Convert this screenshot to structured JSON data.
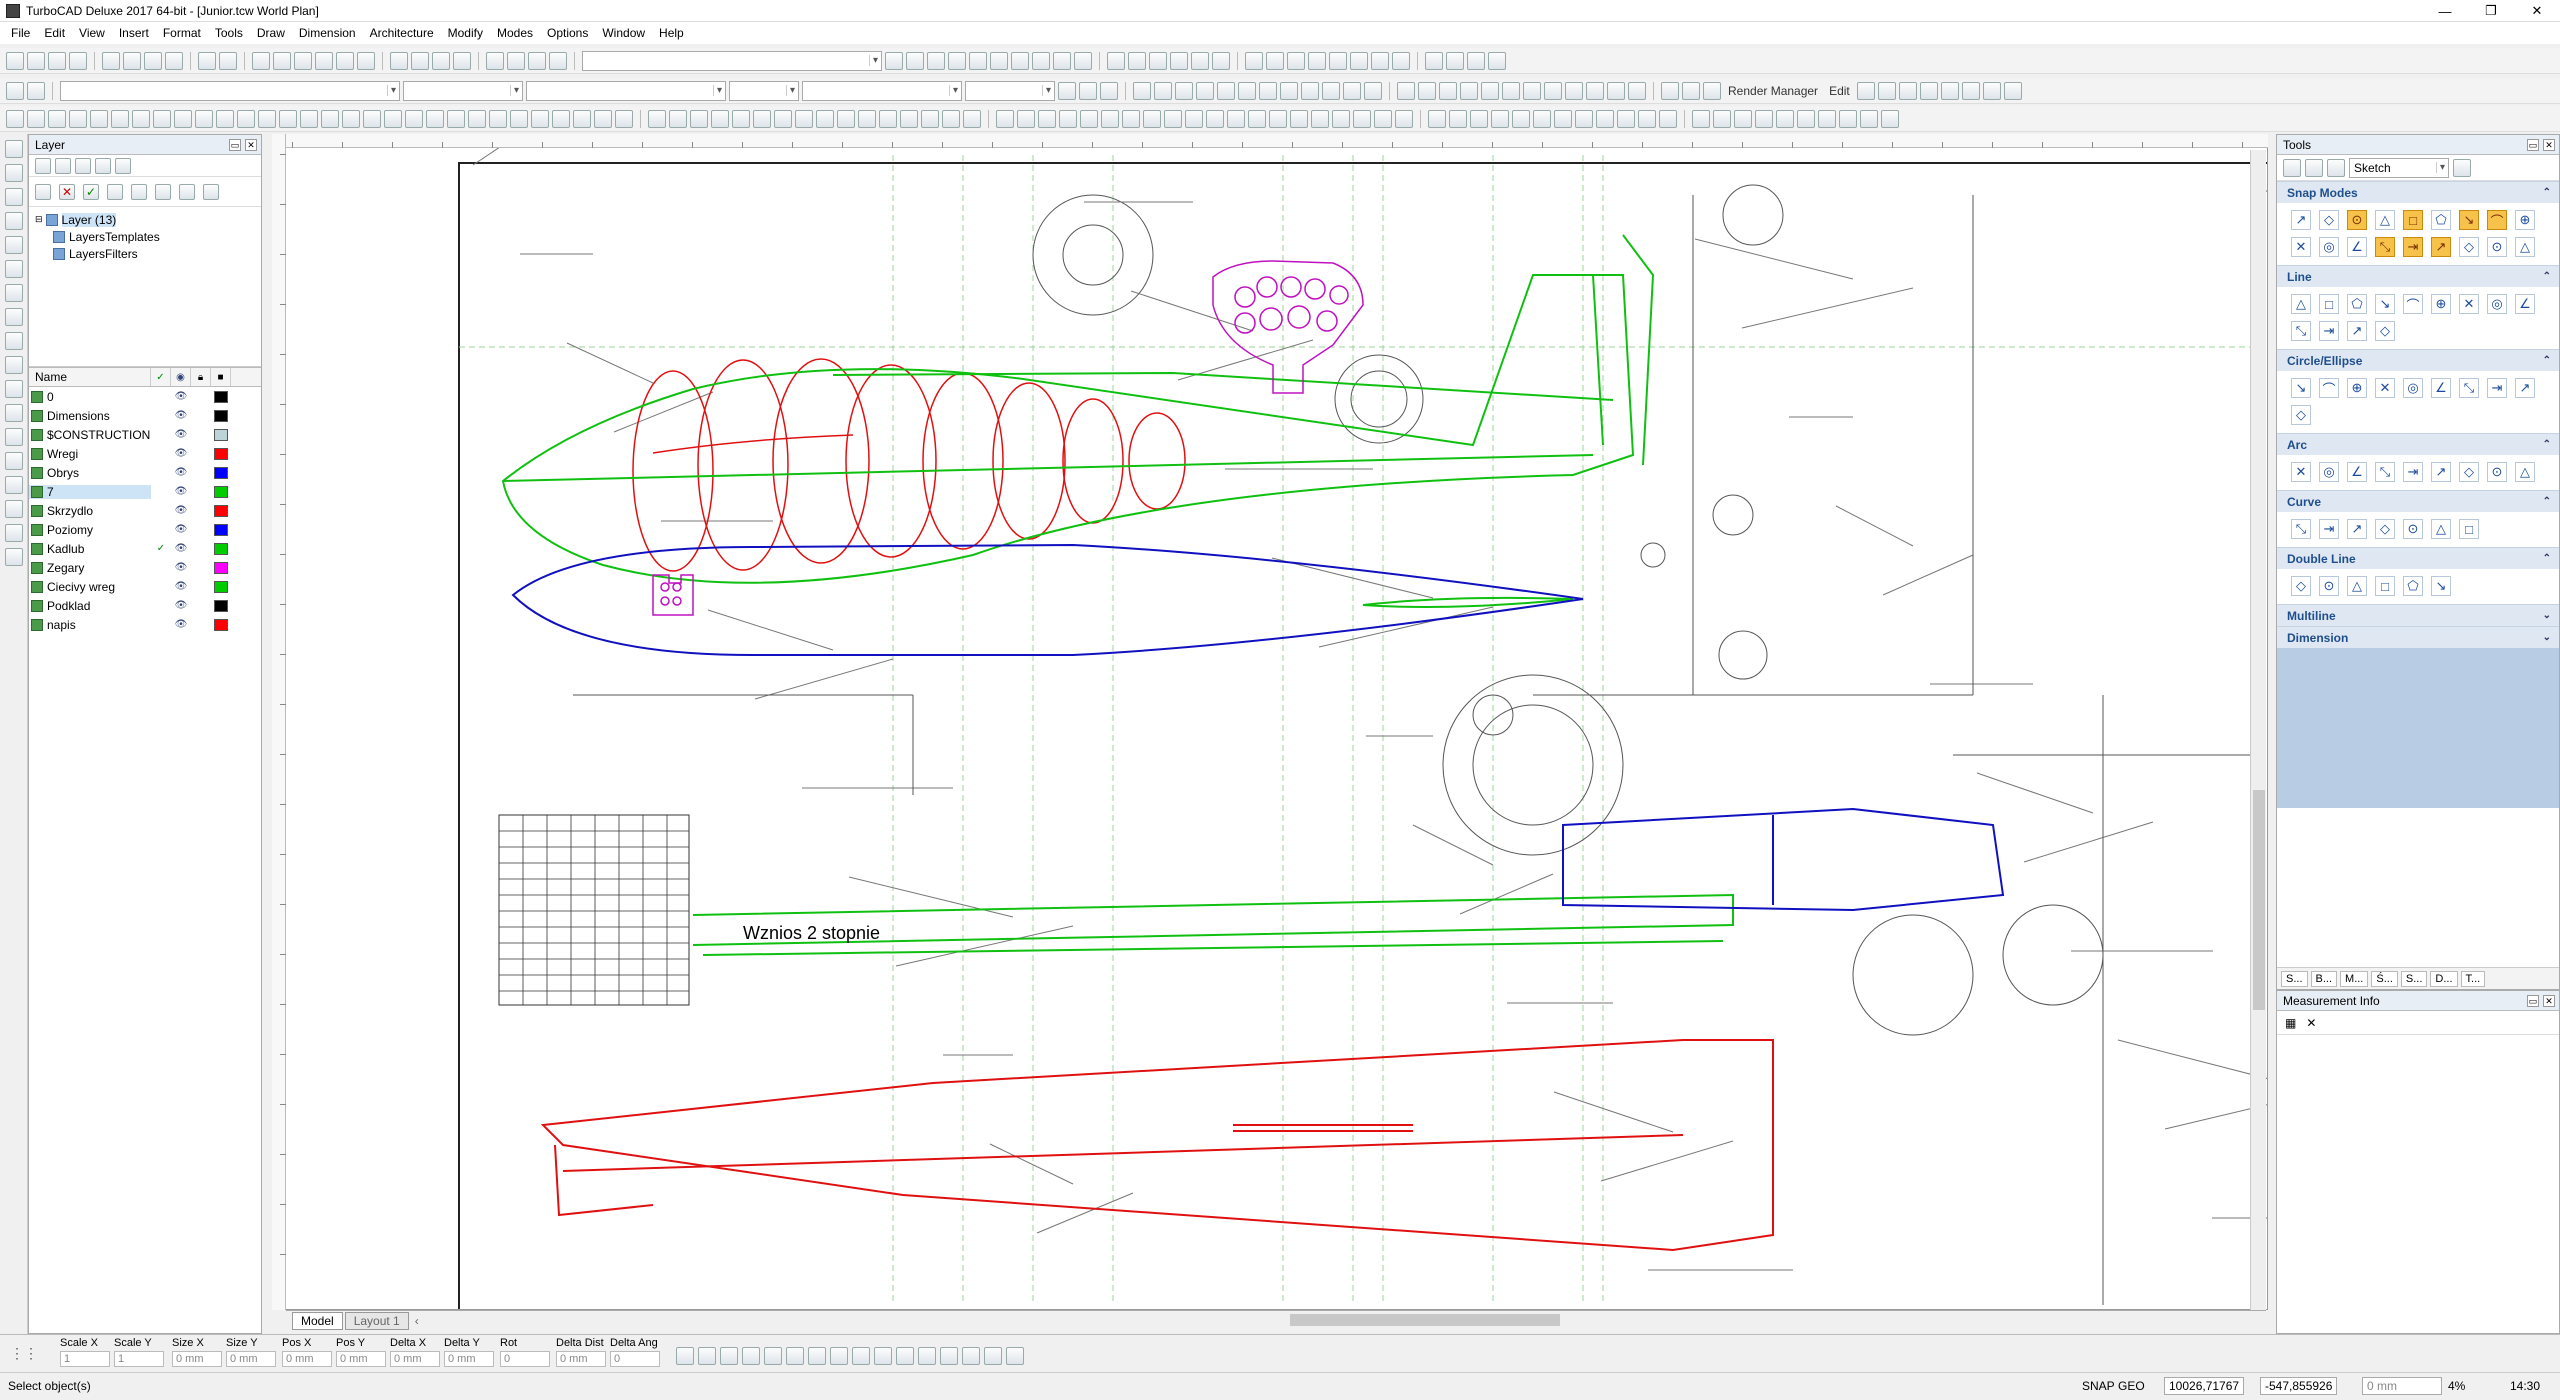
{
  "window": {
    "title": "TurboCAD Deluxe 2017 64-bit - [Junior.tcw World Plan]",
    "controls": [
      "—",
      "❐",
      "✕"
    ]
  },
  "menu": [
    "File",
    "Edit",
    "View",
    "Insert",
    "Format",
    "Tools",
    "Draw",
    "Dimension",
    "Architecture",
    "Modify",
    "Modes",
    "Options",
    "Window",
    "Help"
  ],
  "toolbar": {
    "render_manager_label": "Render Manager",
    "edit_label": "Edit"
  },
  "layer_panel": {
    "title": "Layer",
    "tree": [
      {
        "label": "Layer (13)"
      },
      {
        "label": "LayersTemplates"
      },
      {
        "label": "LayersFilters"
      }
    ],
    "columns": {
      "name": "Name"
    },
    "layers": [
      {
        "name": "0",
        "visible": true,
        "current": false,
        "color": "#000000"
      },
      {
        "name": "Dimensions",
        "visible": true,
        "current": false,
        "color": "#000000"
      },
      {
        "name": "$CONSTRUCTION",
        "visible": true,
        "current": false,
        "color": "#bcd3d8"
      },
      {
        "name": "Wregi",
        "visible": true,
        "current": false,
        "color": "#ff0000"
      },
      {
        "name": "Obrys",
        "visible": true,
        "current": false,
        "color": "#0000ff"
      },
      {
        "name": "7",
        "visible": true,
        "current": false,
        "color": "#00cc00"
      },
      {
        "name": "Skrzydlo",
        "visible": true,
        "current": false,
        "color": "#ff0000"
      },
      {
        "name": "Poziomy",
        "visible": true,
        "current": false,
        "color": "#0000ff"
      },
      {
        "name": "Kadlub",
        "visible": true,
        "current": true,
        "color": "#00cc00"
      },
      {
        "name": "Zegary",
        "visible": true,
        "current": false,
        "color": "#ff00ff"
      },
      {
        "name": "Ciecivy wreg",
        "visible": true,
        "current": false,
        "color": "#00cc00"
      },
      {
        "name": "Podklad",
        "visible": true,
        "current": false,
        "color": "#000000"
      },
      {
        "name": "napis",
        "visible": true,
        "current": false,
        "color": "#ff0000"
      }
    ],
    "selected_layer": "7"
  },
  "drawing": {
    "annotation_text": "Wznios 2 stopnie",
    "tabs": [
      "Model",
      "Layout 1"
    ]
  },
  "tools_panel": {
    "title": "Tools",
    "mode_value": "Sketch",
    "sections": [
      "Snap Modes",
      "Line",
      "Circle/Ellipse",
      "Arc",
      "Curve",
      "Double Line",
      "Multiline",
      "Dimension"
    ],
    "bottom_tabs": [
      "S...",
      "B...",
      "M...",
      "Ś...",
      "S...",
      "D...",
      "T..."
    ]
  },
  "measurement_panel": {
    "title": "Measurement Info"
  },
  "inspector": {
    "fields": [
      {
        "label": "Scale X",
        "value": "1"
      },
      {
        "label": "Scale Y",
        "value": "1"
      },
      {
        "label": "Size X",
        "value": "0 mm"
      },
      {
        "label": "Size Y",
        "value": "0 mm"
      },
      {
        "label": "Pos X",
        "value": "0 mm"
      },
      {
        "label": "Pos Y",
        "value": "0 mm"
      },
      {
        "label": "Delta X",
        "value": "0 mm"
      },
      {
        "label": "Delta Y",
        "value": "0 mm"
      },
      {
        "label": "Rot",
        "value": "0"
      },
      {
        "label": "Delta Dist",
        "value": "0 mm"
      },
      {
        "label": "Delta Ang",
        "value": "0"
      }
    ]
  },
  "status": {
    "message": "Select object(s)",
    "snap": "SNAP",
    "geo": "GEO",
    "coord_x": "10026,71767",
    "coord_y": "-547,855926",
    "coord_z": "0 mm",
    "zoom": "4%",
    "time": "14:30"
  },
  "colors": {
    "wing_red": "#e01010",
    "fuselage_green": "#10c010",
    "outline_blue": "#1010c0",
    "instrument_magenta": "#c010c0"
  }
}
